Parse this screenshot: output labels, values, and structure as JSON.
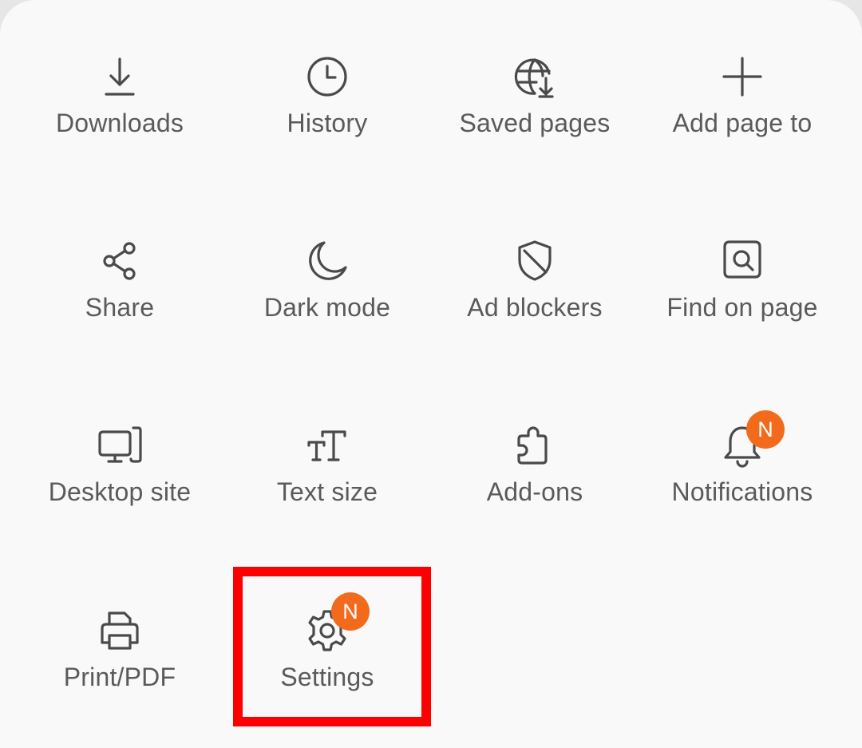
{
  "menu": {
    "items": [
      {
        "id": "downloads",
        "label": "Downloads",
        "icon": "download-icon"
      },
      {
        "id": "history",
        "label": "History",
        "icon": "clock-icon"
      },
      {
        "id": "saved-pages",
        "label": "Saved pages",
        "icon": "globe-download-icon"
      },
      {
        "id": "add-page-to",
        "label": "Add page to",
        "icon": "plus-icon"
      },
      {
        "id": "share",
        "label": "Share",
        "icon": "share-icon"
      },
      {
        "id": "dark-mode",
        "label": "Dark mode",
        "icon": "moon-icon"
      },
      {
        "id": "ad-blockers",
        "label": "Ad blockers",
        "icon": "shield-icon"
      },
      {
        "id": "find-on-page",
        "label": "Find on page",
        "icon": "find-page-icon"
      },
      {
        "id": "desktop-site",
        "label": "Desktop site",
        "icon": "desktop-icon"
      },
      {
        "id": "text-size",
        "label": "Text size",
        "icon": "text-size-icon"
      },
      {
        "id": "add-ons",
        "label": "Add-ons",
        "icon": "puzzle-icon"
      },
      {
        "id": "notifications",
        "label": "Notifications",
        "icon": "bell-icon",
        "badge": "N"
      },
      {
        "id": "print-pdf",
        "label": "Print/PDF",
        "icon": "printer-icon"
      },
      {
        "id": "settings",
        "label": "Settings",
        "icon": "gear-icon",
        "badge": "N",
        "highlighted": true
      }
    ]
  },
  "colors": {
    "background": "#f9f9f9",
    "icon": "#4a4a4a",
    "label": "#5a5a5a",
    "badge": "#f26b1d",
    "highlight": "#ff0000"
  }
}
